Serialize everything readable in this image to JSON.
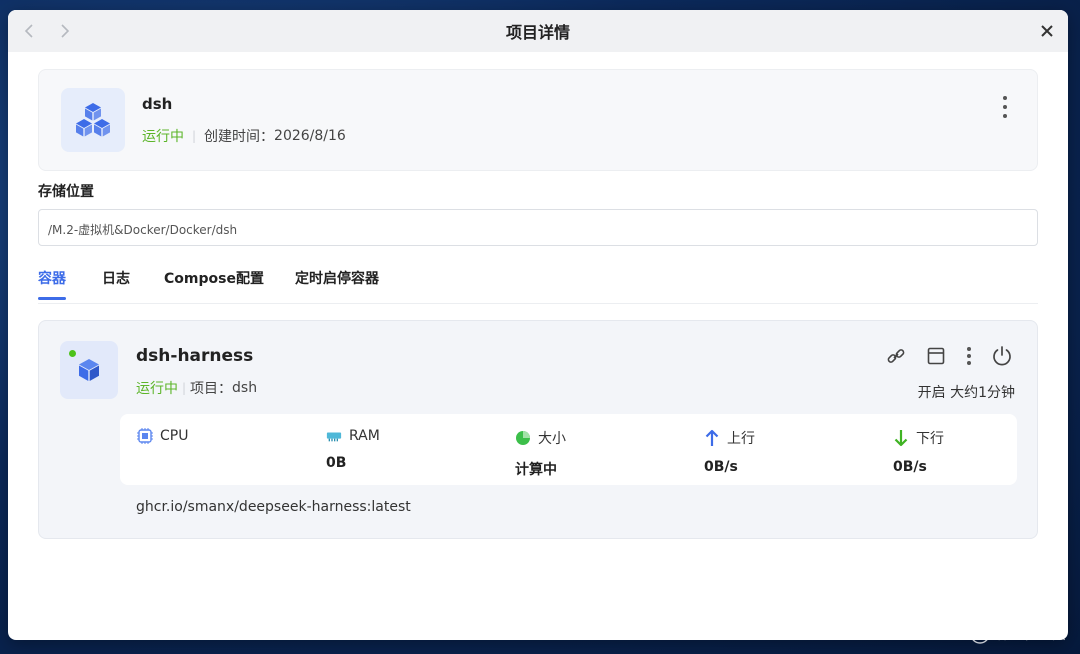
{
  "window": {
    "title": "项目详情"
  },
  "project": {
    "name": "dsh",
    "status": "运行中",
    "created_label": "创建时间：",
    "created_value": "2026/8/16"
  },
  "storage": {
    "label": "存储位置",
    "path": "/M.2-虚拟机&Docker/Docker/dsh"
  },
  "tabs": [
    {
      "label": "容器",
      "active": true
    },
    {
      "label": "日志",
      "active": false
    },
    {
      "label": "Compose配置",
      "active": false
    },
    {
      "label": "定时启停容器",
      "active": false
    }
  ],
  "container": {
    "name": "dsh-harness",
    "status": "运行中",
    "project_label": "项目：",
    "project_value": "dsh",
    "uptime": "开启 大约1分钟",
    "image": "ghcr.io/smanx/deepseek-harness:latest",
    "stats": [
      {
        "icon": "cpu-icon",
        "label": "CPU",
        "value": ""
      },
      {
        "icon": "ram-icon",
        "label": "RAM",
        "value": "0B"
      },
      {
        "icon": "pie-chart-icon",
        "label": "大小",
        "value": "计算中"
      },
      {
        "icon": "arrow-up-icon",
        "label": "上行",
        "value": "0B/s"
      },
      {
        "icon": "arrow-down-icon",
        "label": "下行",
        "value": "0B/s"
      }
    ]
  },
  "watermark": {
    "text": "什么值得买",
    "badge": "值"
  },
  "colors": {
    "accent": "#3d6ce8",
    "running": "#5cb529",
    "up_arrow": "#3d6ce8",
    "down_arrow": "#3fb323"
  }
}
